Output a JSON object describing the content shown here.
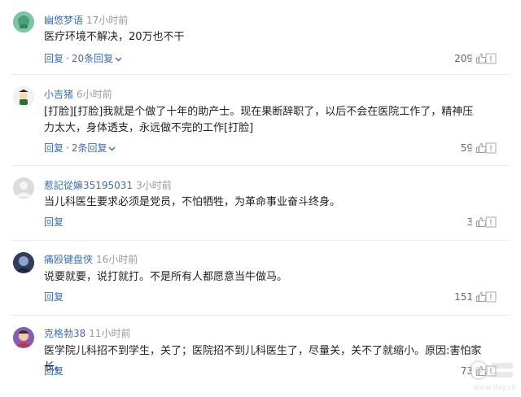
{
  "comments": [
    {
      "name": "幽悠梦语",
      "time": "17小时前",
      "text": "医疗环境不解决，20万也不干",
      "reply_label": "回复",
      "replies_label": "20条回复",
      "likes": "209"
    },
    {
      "name": "小吉猪",
      "time": "6小时前",
      "text": "[打脸][打脸]我就是个做了十年的助产士。现在果断辞职了，以后不会在医院工作了，精神压力太大，身体透支，永远做不完的工作[打脸]",
      "reply_label": "回复",
      "replies_label": "2条回复",
      "likes": "59"
    },
    {
      "name": "惹記從嫲35195031",
      "time": "3小时前",
      "text": "当儿科医生要求必须是党员，不怕牺牲，为革命事业奋斗终身。",
      "reply_label": "回复",
      "likes": "3"
    },
    {
      "name": "痛殴键盘侠",
      "time": "16小时前",
      "text": "说要就要，说打就打。不是所有人都愿意当牛做马。",
      "reply_label": "回复",
      "likes": "151"
    },
    {
      "name": "克格勃38",
      "time": "11小时前",
      "text": "医学院儿科招不到学生，关了；医院招不到儿科医生了，尽量关，关不了就缩小。原因:害怕家长。",
      "reply_label": "回复",
      "likes": "73"
    }
  ],
  "watermark": {
    "url": "www.dxy.cn"
  },
  "colors": {
    "link": "#3a6fb4",
    "muted": "#999999",
    "divider": "#ececec"
  }
}
